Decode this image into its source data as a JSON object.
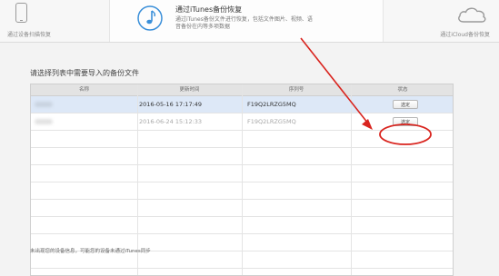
{
  "tabs": {
    "device": {
      "label": "通过设备扫描恢复",
      "icon": "phone-icon"
    },
    "itunes": {
      "title": "通过iTunes备份恢复",
      "description": "通过iTunes备份文件进行恢复，包括文件图片、视频、语音备份在内等多项数据",
      "icon": "music-note-icon",
      "active": true
    },
    "icloud": {
      "label": "通过iCloud备份恢复",
      "icon": "cloud-icon"
    }
  },
  "instruction": "请选择列表中需要导入的备份文件",
  "table": {
    "columns": [
      "名称",
      "更新时间",
      "序列号",
      "状态"
    ],
    "rows": [
      {
        "name": "",
        "time": "2016-05-16 17:17:49",
        "serial": "F19Q2LRZG5MQ",
        "action": "选定",
        "selected": true
      },
      {
        "name": "",
        "time": "2016-06-24 15:12:33",
        "serial": "F19Q2LRZG5MQ",
        "action": "选定",
        "selected": false
      }
    ]
  },
  "footer_note": "未出现您的设备信息，可能您的设备未通过iTunes同步",
  "colors": {
    "selected_row": "#dde8f7",
    "annotation": "#d9241e"
  }
}
